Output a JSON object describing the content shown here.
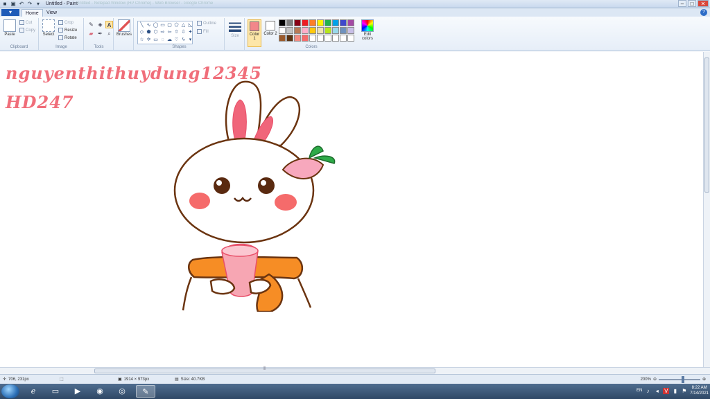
{
  "window": {
    "title": "Untitled - Paint",
    "background_tabs": "Untitled - Notepad   Window (HP Chrome) - Web Browser   - Google Chrome"
  },
  "tabs": {
    "app_menu": "▾",
    "home": "Home",
    "view": "View"
  },
  "ribbon": {
    "clipboard": {
      "label": "Clipboard",
      "paste": "Paste",
      "cut": "Cut",
      "copy": "Copy"
    },
    "image": {
      "label": "Image",
      "select": "Select",
      "crop": "Crop",
      "resize": "Resize",
      "rotate": "Rotate"
    },
    "tools": {
      "label": "Tools"
    },
    "brushes": {
      "label": "Brushes"
    },
    "shapes": {
      "label": "Shapes",
      "outline": "Outline",
      "fill": "Fill"
    },
    "size": {
      "label": "Size"
    },
    "colors": {
      "label": "Colors",
      "color1": "Color 1",
      "color2": "Color 2",
      "edit_colors": "Edit colors",
      "color1_value": "#f2878a",
      "color2_value": "#ffffff",
      "palette": [
        "#000000",
        "#7f7f7f",
        "#880015",
        "#ed1c24",
        "#ff7f27",
        "#fff200",
        "#22b14c",
        "#00a2e8",
        "#3f48cc",
        "#a349a4",
        "#ffffff",
        "#c3c3c3",
        "#b97a57",
        "#ffaec9",
        "#ffc90e",
        "#efe4b0",
        "#b5e61d",
        "#99d9ea",
        "#7092be",
        "#c8bfe7",
        "#9b5a2b",
        "#5a3312",
        "#f28b82",
        "#f56b6b",
        "#ffffff",
        "#ffffff",
        "#ffffff",
        "#ffffff",
        "#ffffff",
        "#ffffff"
      ]
    }
  },
  "canvas": {
    "text_line1": "nguyenthithuydung12345",
    "text_line2": "HD247"
  },
  "statusbar": {
    "cursor_pos": "706, 231px",
    "selection_size": "",
    "image_size": "1914 × 973px",
    "file_size": "Size: 40.7KB",
    "zoom": "200%"
  },
  "taskbar": {
    "language": "EN",
    "time": "8:22 AM",
    "date": "7/14/2021"
  }
}
